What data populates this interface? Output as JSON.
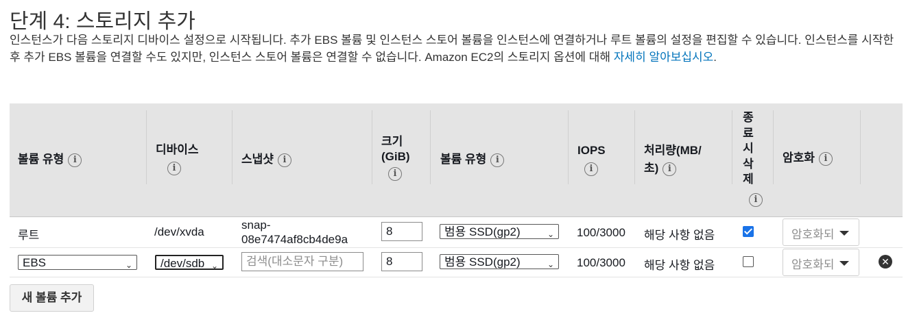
{
  "page": {
    "title": "단계 4: 스토리지 추가",
    "description": "인스턴스가 다음 스토리지 디바이스 설정으로 시작됩니다. 추가 EBS 볼륨 및 인스턴스 스토어 볼륨을 인스턴스에 연결하거나 루트 볼륨의 설정을 편집할 수 있습니다. 인스턴스를 시작한 후 추가 EBS 볼륨을 연결할 수도 있지만, 인스턴스 스토어 볼륨은 연결할 수 없습니다. Amazon EC2의 스토리지 옵션에 대해 ",
    "learn_more_link": "자세히 알아보십시오",
    "period": "."
  },
  "table": {
    "headers": {
      "volume_type": "볼륨 유형",
      "device": "디바이스",
      "snapshot": "스냅샷",
      "size_line1": "크기",
      "size_line2": "(GiB)",
      "ebs_volume_type": "볼륨 유형",
      "iops": "IOPS",
      "throughput_line1": "처리량(MB/",
      "throughput_line2": "초)",
      "delete_on_termination": [
        "종",
        "료",
        "시",
        "삭",
        "제"
      ],
      "encryption": "암호화",
      "info_glyph": "i"
    },
    "rows": [
      {
        "volume_type": "루트",
        "device": "/dev/xvda",
        "snapshot_line1": "snap-",
        "snapshot_line2": "08e7474af8cb4de9a",
        "size": "8",
        "ebs_volume_type": "범용 SSD(gp2)",
        "iops": "100/3000",
        "throughput": "해당 사항 없음",
        "delete_on_termination": true,
        "encryption": "암호화되지 않음"
      },
      {
        "volume_type": "EBS",
        "device": "/dev/sdb",
        "snapshot_placeholder": "검색(대소문자 구분)",
        "size": "8",
        "ebs_volume_type": "범용 SSD(gp2)",
        "iops": "100/3000",
        "throughput": "해당 사항 없음",
        "delete_on_termination": false,
        "encryption": "암호화되지 않음"
      }
    ]
  },
  "icons": {
    "info": "info-icon",
    "select_arrow": "chevron-down-icon",
    "remove": "close-circle-icon",
    "select_arrow_glyph": "⌄",
    "remove_glyph": "✕"
  },
  "add_volume_button": "새 볼륨 추가",
  "colors": {
    "header_bg": "#e4e4e4",
    "link": "#0073bb",
    "checkbox_checked": "#1a73e8"
  }
}
